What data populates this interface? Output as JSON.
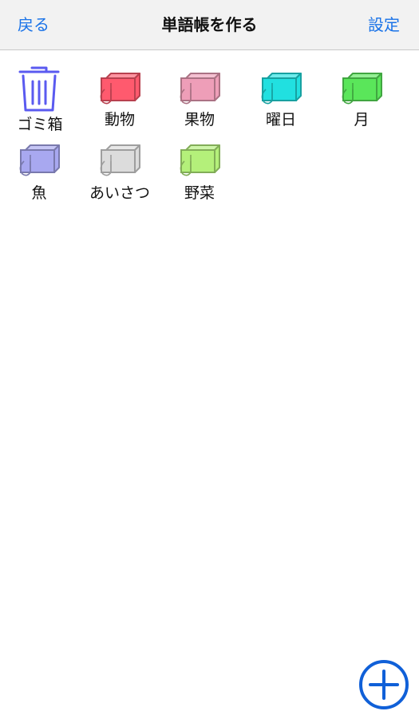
{
  "nav": {
    "back_label": "戻る",
    "title": "単語帳を作る",
    "settings_label": "設定"
  },
  "trash": {
    "label": "ゴミ箱",
    "icon": "trash-icon",
    "color": "#5a5af0"
  },
  "folders": [
    {
      "label": "動物",
      "color": "#ff5a6e"
    },
    {
      "label": "果物",
      "color": "#ee9eb8"
    },
    {
      "label": "曜日",
      "color": "#21e0e0"
    },
    {
      "label": "月",
      "color": "#5ae65a"
    },
    {
      "label": "魚",
      "color": "#a8a8f0"
    },
    {
      "label": "あいさつ",
      "color": "#dcdcdc"
    },
    {
      "label": "野菜",
      "color": "#b4f07a"
    }
  ],
  "add_button": {
    "icon": "plus-circle-icon",
    "color": "#1060d8"
  }
}
